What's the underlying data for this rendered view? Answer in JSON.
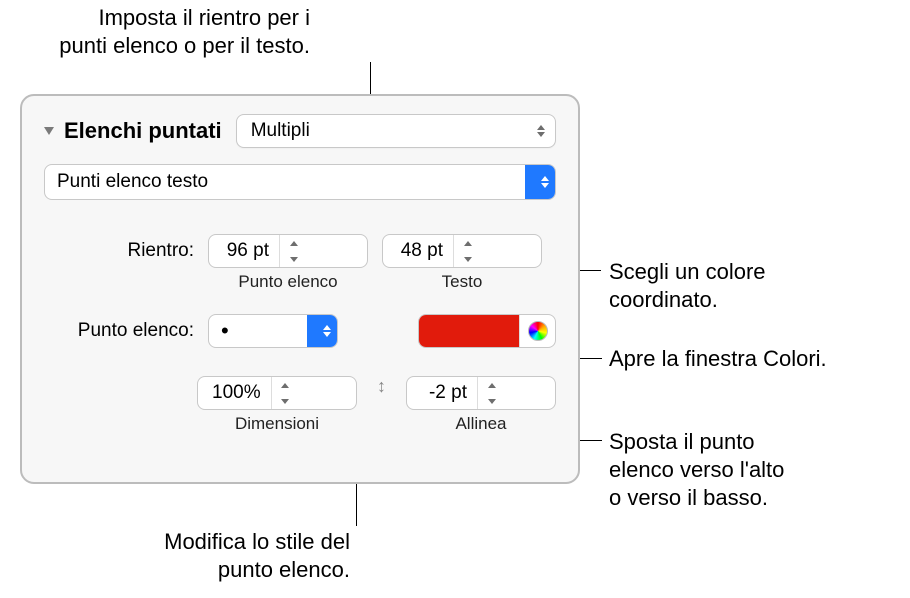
{
  "callouts": {
    "indent": "Imposta il rientro per i\npunti elenco o per il testo.",
    "coord_color": "Scegli un colore\ncoordinato.",
    "opens_colors": "Apre la finestra Colori.",
    "move_bullet": "Sposta il punto\nelenco verso l'alto\no verso il basso.",
    "change_style": "Modifica lo stile del\npunto elenco."
  },
  "panel": {
    "section_title": "Elenchi puntati",
    "style_popup": "Multipli",
    "format_popup": "Punti elenco testo",
    "indent": {
      "label": "Rientro:",
      "bullet_value": "96 pt",
      "bullet_caption": "Punto elenco",
      "text_value": "48 pt",
      "text_caption": "Testo"
    },
    "bullet": {
      "label": "Punto elenco:",
      "glyph": "•",
      "color": "#e11b0c"
    },
    "size": {
      "value": "100%",
      "caption": "Dimensioni"
    },
    "align": {
      "value": "-2 pt",
      "caption": "Allinea"
    }
  },
  "icons": {
    "disclosure": "disclosure-triangle",
    "chev": "chevron-updown",
    "colorwheel": "color-wheel",
    "vsort": "vertical-align"
  }
}
